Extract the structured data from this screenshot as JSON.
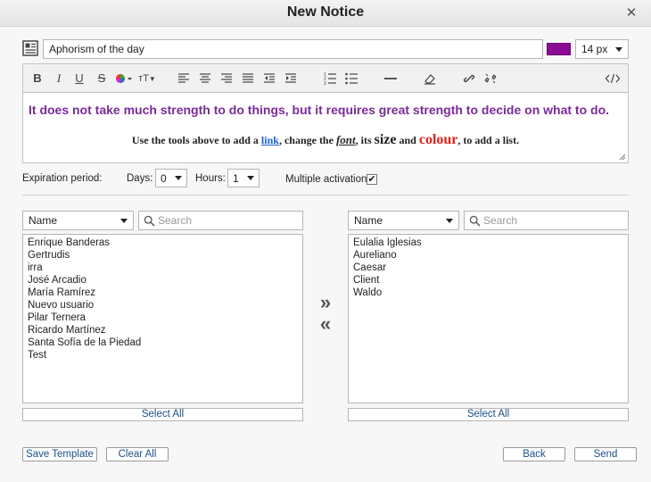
{
  "window": {
    "title": "New Notice"
  },
  "subject": {
    "value": "Aphorism of the day"
  },
  "text_color": "#8b0b93",
  "font_size": {
    "value": "14 px"
  },
  "toolbar": {
    "bold": "B",
    "italic": "I",
    "underline": "U",
    "strike": "S",
    "text_size": "тT"
  },
  "editor": {
    "quote": "It does not take much strength to do things, but it requires great strength to decide on what to do.",
    "instr_a": "Use the tools above to add a ",
    "instr_link": "link",
    "instr_b": ", change the ",
    "instr_font": "font",
    "instr_c": ", its ",
    "instr_size": "size",
    "instr_d": " and ",
    "instr_colour": "colour",
    "instr_e": ", to add a list."
  },
  "expiration": {
    "label": "Expiration period:",
    "days_label": "Days:",
    "days_value": "0",
    "hours_label": "Hours:",
    "hours_value": "1",
    "multiple_label": "Multiple activation:",
    "multiple_checked": "✔"
  },
  "left_panel": {
    "sort_value": "Name",
    "search_placeholder": "Search",
    "items": [
      "Enrique Banderas",
      "Gertrudis",
      "irra",
      "José Arcadio",
      "María Ramírez",
      "Nuevo usuario",
      "Pilar Ternera",
      "Ricardo Martínez",
      "Santa Sofía de la Piedad",
      "Test"
    ],
    "select_all": "Select All"
  },
  "right_panel": {
    "sort_value": "Name",
    "search_placeholder": "Search",
    "items": [
      "Eulalia Iglesias",
      "Aureliano",
      "Caesar",
      "Client",
      "Waldo"
    ],
    "select_all": "Select All"
  },
  "transfer": {
    "add": "»",
    "remove": "«"
  },
  "buttons": {
    "save_template": "Save Template",
    "clear_all": "Clear All",
    "back": "Back",
    "send": "Send"
  }
}
